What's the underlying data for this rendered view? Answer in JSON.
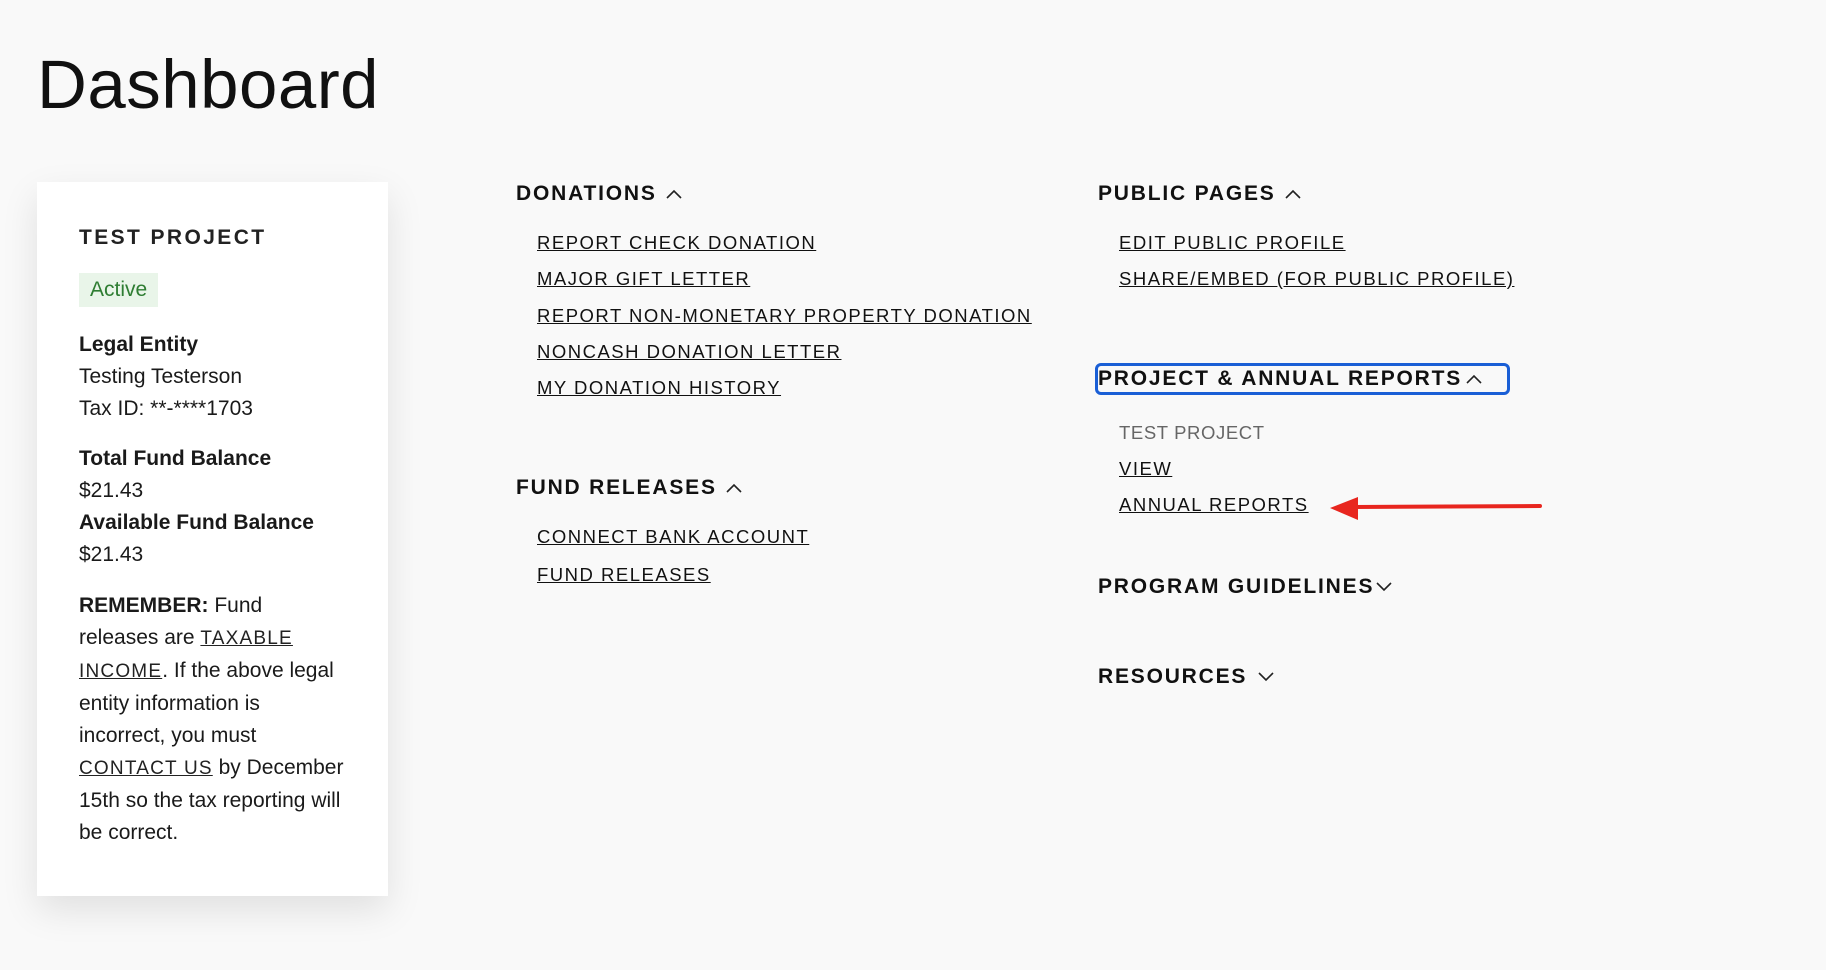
{
  "page": {
    "title": "Dashboard"
  },
  "project_card": {
    "name": "TEST PROJECT",
    "status": "Active",
    "legal_entity_label": "Legal Entity",
    "legal_entity_name": "Testing Testerson",
    "tax_id": "Tax ID: **-****1703",
    "total_fund_label": "Total Fund Balance",
    "total_fund_value": "$21.43",
    "available_fund_label": "Available Fund Balance",
    "available_fund_value": "$21.43",
    "remember_label": "REMEMBER:",
    "remember_text_1": " Fund releases are ",
    "taxable_income_link": "TAXABLE INCOME",
    "remember_text_2": ". If the above legal entity information is incorrect, you must ",
    "contact_us_link": "CONTACT US",
    "remember_text_3": " by December 15th so the tax reporting will be correct."
  },
  "donations": {
    "title": "DONATIONS",
    "expanded": true,
    "links": [
      "REPORT CHECK DONATION",
      "MAJOR GIFT LETTER",
      "REPORT NON-MONETARY PROPERTY DONATION",
      "NONCASH DONATION LETTER",
      "MY DONATION HISTORY"
    ]
  },
  "fund_releases": {
    "title": "FUND RELEASES",
    "expanded": true,
    "links": [
      "CONNECT BANK ACCOUNT",
      "FUND RELEASES"
    ]
  },
  "public_pages": {
    "title": "PUBLIC PAGES",
    "expanded": true,
    "links": [
      "EDIT PUBLIC PROFILE",
      "SHARE/EMBED (FOR PUBLIC PROFILE)"
    ]
  },
  "project_reports": {
    "title": "PROJECT & ANNUAL REPORTS",
    "expanded": true,
    "focused": true,
    "project_name": "TEST PROJECT",
    "links": [
      "VIEW",
      "ANNUAL REPORTS"
    ]
  },
  "program_guidelines": {
    "title": "PROGRAM GUIDELINES",
    "expanded": false
  },
  "resources": {
    "title": "RESOURCES",
    "expanded": false
  },
  "colors": {
    "background": "#f9f9f9",
    "active_badge_bg": "#e9f5e9",
    "active_badge_text": "#2e7d32",
    "focus_ring": "#1a5fd6",
    "annotation_arrow": "#e8261f"
  },
  "icons": {
    "chevron_up": "chevron-up-icon",
    "chevron_down": "chevron-down-icon",
    "annotation_arrow": "red-arrow-annotation"
  }
}
